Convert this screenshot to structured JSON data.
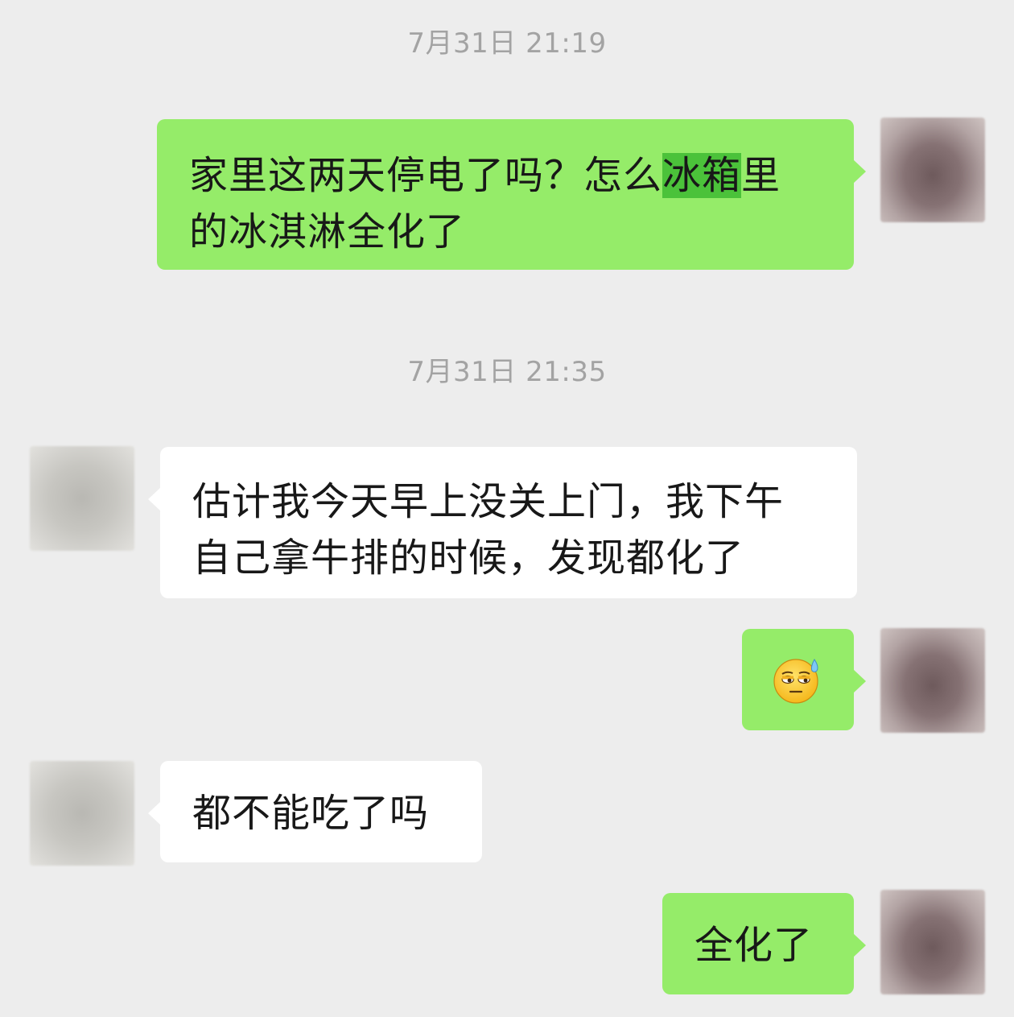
{
  "messages": [
    {
      "type": "timestamp",
      "text": "7月31日 21:19"
    },
    {
      "type": "message",
      "sender": "me",
      "text_before": "家里这两天停电了吗？怎么",
      "text_highlight": "冰箱",
      "text_after": "里",
      "text_line2": "的冰淇淋全化了"
    },
    {
      "type": "timestamp",
      "text": "7月31日 21:35"
    },
    {
      "type": "message",
      "sender": "other",
      "line1": "估计我今天早上没关上门，我下午",
      "line2": "自己拿牛排的时候，发现都化了"
    },
    {
      "type": "message",
      "sender": "me",
      "emoji": "sweat-emoji"
    },
    {
      "type": "message",
      "sender": "other",
      "text": "都不能吃了吗"
    },
    {
      "type": "message",
      "sender": "me",
      "text": "全化了"
    }
  ],
  "colors": {
    "background": "#ededed",
    "my_bubble": "#95ec69",
    "other_bubble": "#ffffff",
    "selection_highlight": "#4bc23a",
    "timestamp_text": "#a3a3a3"
  }
}
